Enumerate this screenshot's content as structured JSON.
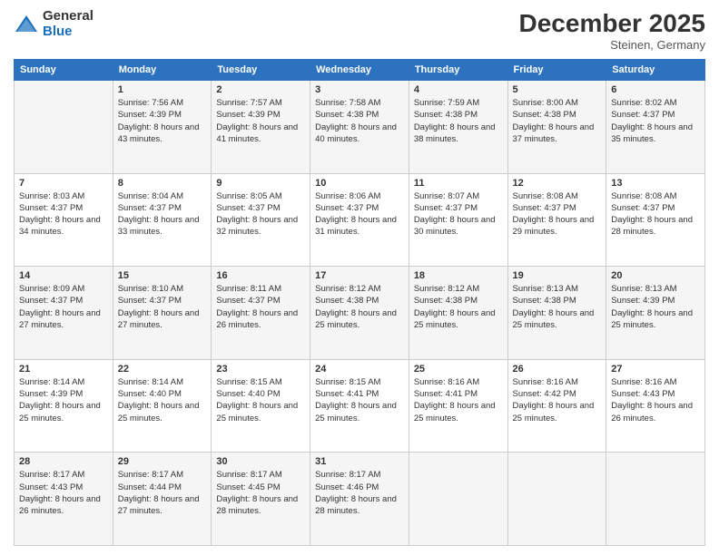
{
  "logo": {
    "general": "General",
    "blue": "Blue"
  },
  "header": {
    "title": "December 2025",
    "location": "Steinen, Germany"
  },
  "days_of_week": [
    "Sunday",
    "Monday",
    "Tuesday",
    "Wednesday",
    "Thursday",
    "Friday",
    "Saturday"
  ],
  "weeks": [
    [
      {
        "num": "",
        "sunrise": "",
        "sunset": "",
        "daylight": ""
      },
      {
        "num": "1",
        "sunrise": "Sunrise: 7:56 AM",
        "sunset": "Sunset: 4:39 PM",
        "daylight": "Daylight: 8 hours and 43 minutes."
      },
      {
        "num": "2",
        "sunrise": "Sunrise: 7:57 AM",
        "sunset": "Sunset: 4:39 PM",
        "daylight": "Daylight: 8 hours and 41 minutes."
      },
      {
        "num": "3",
        "sunrise": "Sunrise: 7:58 AM",
        "sunset": "Sunset: 4:38 PM",
        "daylight": "Daylight: 8 hours and 40 minutes."
      },
      {
        "num": "4",
        "sunrise": "Sunrise: 7:59 AM",
        "sunset": "Sunset: 4:38 PM",
        "daylight": "Daylight: 8 hours and 38 minutes."
      },
      {
        "num": "5",
        "sunrise": "Sunrise: 8:00 AM",
        "sunset": "Sunset: 4:38 PM",
        "daylight": "Daylight: 8 hours and 37 minutes."
      },
      {
        "num": "6",
        "sunrise": "Sunrise: 8:02 AM",
        "sunset": "Sunset: 4:37 PM",
        "daylight": "Daylight: 8 hours and 35 minutes."
      }
    ],
    [
      {
        "num": "7",
        "sunrise": "Sunrise: 8:03 AM",
        "sunset": "Sunset: 4:37 PM",
        "daylight": "Daylight: 8 hours and 34 minutes."
      },
      {
        "num": "8",
        "sunrise": "Sunrise: 8:04 AM",
        "sunset": "Sunset: 4:37 PM",
        "daylight": "Daylight: 8 hours and 33 minutes."
      },
      {
        "num": "9",
        "sunrise": "Sunrise: 8:05 AM",
        "sunset": "Sunset: 4:37 PM",
        "daylight": "Daylight: 8 hours and 32 minutes."
      },
      {
        "num": "10",
        "sunrise": "Sunrise: 8:06 AM",
        "sunset": "Sunset: 4:37 PM",
        "daylight": "Daylight: 8 hours and 31 minutes."
      },
      {
        "num": "11",
        "sunrise": "Sunrise: 8:07 AM",
        "sunset": "Sunset: 4:37 PM",
        "daylight": "Daylight: 8 hours and 30 minutes."
      },
      {
        "num": "12",
        "sunrise": "Sunrise: 8:08 AM",
        "sunset": "Sunset: 4:37 PM",
        "daylight": "Daylight: 8 hours and 29 minutes."
      },
      {
        "num": "13",
        "sunrise": "Sunrise: 8:08 AM",
        "sunset": "Sunset: 4:37 PM",
        "daylight": "Daylight: 8 hours and 28 minutes."
      }
    ],
    [
      {
        "num": "14",
        "sunrise": "Sunrise: 8:09 AM",
        "sunset": "Sunset: 4:37 PM",
        "daylight": "Daylight: 8 hours and 27 minutes."
      },
      {
        "num": "15",
        "sunrise": "Sunrise: 8:10 AM",
        "sunset": "Sunset: 4:37 PM",
        "daylight": "Daylight: 8 hours and 27 minutes."
      },
      {
        "num": "16",
        "sunrise": "Sunrise: 8:11 AM",
        "sunset": "Sunset: 4:37 PM",
        "daylight": "Daylight: 8 hours and 26 minutes."
      },
      {
        "num": "17",
        "sunrise": "Sunrise: 8:12 AM",
        "sunset": "Sunset: 4:38 PM",
        "daylight": "Daylight: 8 hours and 25 minutes."
      },
      {
        "num": "18",
        "sunrise": "Sunrise: 8:12 AM",
        "sunset": "Sunset: 4:38 PM",
        "daylight": "Daylight: 8 hours and 25 minutes."
      },
      {
        "num": "19",
        "sunrise": "Sunrise: 8:13 AM",
        "sunset": "Sunset: 4:38 PM",
        "daylight": "Daylight: 8 hours and 25 minutes."
      },
      {
        "num": "20",
        "sunrise": "Sunrise: 8:13 AM",
        "sunset": "Sunset: 4:39 PM",
        "daylight": "Daylight: 8 hours and 25 minutes."
      }
    ],
    [
      {
        "num": "21",
        "sunrise": "Sunrise: 8:14 AM",
        "sunset": "Sunset: 4:39 PM",
        "daylight": "Daylight: 8 hours and 25 minutes."
      },
      {
        "num": "22",
        "sunrise": "Sunrise: 8:14 AM",
        "sunset": "Sunset: 4:40 PM",
        "daylight": "Daylight: 8 hours and 25 minutes."
      },
      {
        "num": "23",
        "sunrise": "Sunrise: 8:15 AM",
        "sunset": "Sunset: 4:40 PM",
        "daylight": "Daylight: 8 hours and 25 minutes."
      },
      {
        "num": "24",
        "sunrise": "Sunrise: 8:15 AM",
        "sunset": "Sunset: 4:41 PM",
        "daylight": "Daylight: 8 hours and 25 minutes."
      },
      {
        "num": "25",
        "sunrise": "Sunrise: 8:16 AM",
        "sunset": "Sunset: 4:41 PM",
        "daylight": "Daylight: 8 hours and 25 minutes."
      },
      {
        "num": "26",
        "sunrise": "Sunrise: 8:16 AM",
        "sunset": "Sunset: 4:42 PM",
        "daylight": "Daylight: 8 hours and 25 minutes."
      },
      {
        "num": "27",
        "sunrise": "Sunrise: 8:16 AM",
        "sunset": "Sunset: 4:43 PM",
        "daylight": "Daylight: 8 hours and 26 minutes."
      }
    ],
    [
      {
        "num": "28",
        "sunrise": "Sunrise: 8:17 AM",
        "sunset": "Sunset: 4:43 PM",
        "daylight": "Daylight: 8 hours and 26 minutes."
      },
      {
        "num": "29",
        "sunrise": "Sunrise: 8:17 AM",
        "sunset": "Sunset: 4:44 PM",
        "daylight": "Daylight: 8 hours and 27 minutes."
      },
      {
        "num": "30",
        "sunrise": "Sunrise: 8:17 AM",
        "sunset": "Sunset: 4:45 PM",
        "daylight": "Daylight: 8 hours and 28 minutes."
      },
      {
        "num": "31",
        "sunrise": "Sunrise: 8:17 AM",
        "sunset": "Sunset: 4:46 PM",
        "daylight": "Daylight: 8 hours and 28 minutes."
      },
      {
        "num": "",
        "sunrise": "",
        "sunset": "",
        "daylight": ""
      },
      {
        "num": "",
        "sunrise": "",
        "sunset": "",
        "daylight": ""
      },
      {
        "num": "",
        "sunrise": "",
        "sunset": "",
        "daylight": ""
      }
    ]
  ]
}
